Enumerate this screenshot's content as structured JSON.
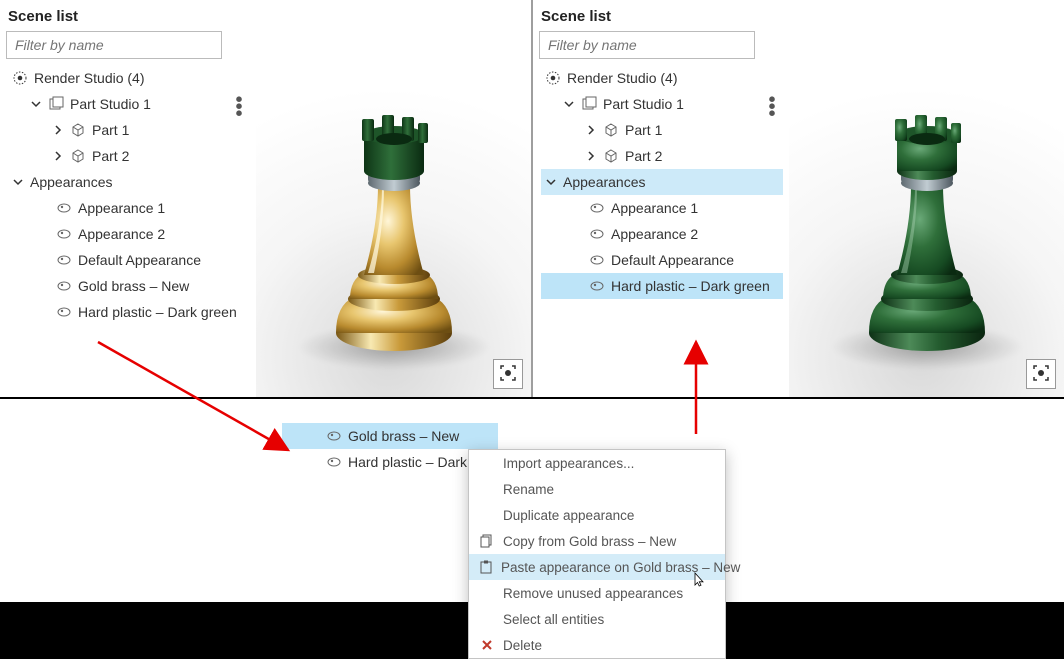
{
  "left_panel": {
    "title": "Scene list",
    "filter_placeholder": "Filter by name",
    "root": "Render Studio (4)",
    "studio": "Part Studio 1",
    "part1": "Part 1",
    "part2": "Part 2",
    "appearances_group": "Appearances",
    "app1": "Appearance 1",
    "app2": "Appearance 2",
    "app_default": "Default Appearance",
    "app_gold": "Gold brass – New",
    "app_green": "Hard plastic – Dark green"
  },
  "right_panel": {
    "title": "Scene list",
    "filter_placeholder": "Filter by name",
    "root": "Render Studio (4)",
    "studio": "Part Studio 1",
    "part1": "Part 1",
    "part2": "Part 2",
    "appearances_group": "Appearances",
    "app1": "Appearance 1",
    "app2": "Appearance 2",
    "app_default": "Default Appearance",
    "app_green": "Hard plastic – Dark green"
  },
  "ctx_tree": {
    "gold": "Gold brass – New",
    "green": "Hard plastic – Dark"
  },
  "context_menu": {
    "import": "Import appearances...",
    "rename": "Rename",
    "duplicate": "Duplicate appearance",
    "copy": "Copy from Gold brass – New",
    "paste": "Paste appearance on Gold brass – New",
    "remove": "Remove unused appearances",
    "select_all": "Select all entities",
    "delete": "Delete"
  }
}
